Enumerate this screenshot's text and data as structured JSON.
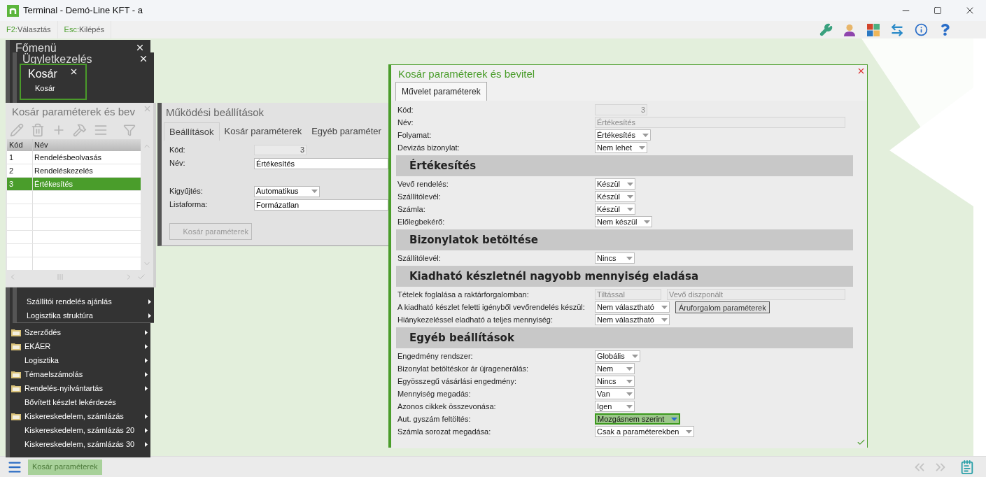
{
  "window": {
    "title": "Terminal - Demó-Line KFT - a"
  },
  "hints": [
    {
      "key": "F2:",
      "label": "Választás"
    },
    {
      "key": "Esc:",
      "label": "Kilépés"
    }
  ],
  "main_menu": {
    "title": "Főmenü",
    "items": [
      {
        "label": "Szerződés",
        "icon": true,
        "submenu": true
      },
      {
        "label": "EKÁER",
        "icon": true,
        "submenu": true
      },
      {
        "label": "Logisztika",
        "icon": false,
        "submenu": true
      },
      {
        "label": "Témaelszámolás",
        "icon": true,
        "submenu": true
      },
      {
        "label": "Rendelés-nyilvántartás",
        "icon": true,
        "submenu": true
      },
      {
        "label": "Bővített készlet lekérdezés",
        "icon": false,
        "submenu": false
      },
      {
        "label": "Kiskereskedelem, számlázás",
        "icon": true,
        "submenu": true
      },
      {
        "label": "Kiskereskedelem, számlázás 20",
        "icon": false,
        "submenu": true
      },
      {
        "label": "Kiskereskedelem, számlázás 30",
        "icon": false,
        "submenu": true
      }
    ]
  },
  "sub_menu": {
    "title": "Ügyletkezelés",
    "items": [
      {
        "label": "Szállítói rendelés ajánlás",
        "submenu": true
      },
      {
        "label": "Logisztika struktúra",
        "submenu": true
      }
    ]
  },
  "basket_menu": {
    "title": "Kosár",
    "items": [
      {
        "label": "Kosár"
      }
    ]
  },
  "list_window": {
    "title": "Kosár paraméterek és bev",
    "columns": [
      "Kód",
      "Név"
    ],
    "rows": [
      {
        "code": "1",
        "name": "Rendelésbeolvasás",
        "selected": false
      },
      {
        "code": "2",
        "name": "Rendeléskezelés",
        "selected": false
      },
      {
        "code": "3",
        "name": "Értékesítés",
        "selected": true
      }
    ]
  },
  "settings_window": {
    "title": "Működési beállítások",
    "tabs": [
      {
        "label": "Beállítások",
        "selected": true
      },
      {
        "label": "Kosár paraméterek",
        "selected": false
      },
      {
        "label": "Egyéb paraméter",
        "selected": false
      }
    ],
    "fields": [
      {
        "label": "Kód:",
        "value": "3",
        "kind": "number"
      },
      {
        "label": "Név:",
        "value": "Értékesítés",
        "kind": "text"
      },
      {
        "label": "Kigyűjtés:",
        "value": "Automatikus",
        "kind": "select"
      },
      {
        "label": "Listaforma:",
        "value": "Formázatlan",
        "kind": "text"
      }
    ],
    "button": {
      "label": "Kosár paraméterek",
      "disabled": true
    }
  },
  "dialog": {
    "title": "Kosár paraméterek és bevitel",
    "tabs": [
      {
        "label": "Művelet paraméterek",
        "selected": true
      }
    ],
    "rows": [
      {
        "kind": "number",
        "label": "Kód:",
        "value": "3",
        "disabled": true,
        "focused": false
      },
      {
        "kind": "text",
        "label": "Név:",
        "value": "Értékesítés",
        "disabled": true,
        "focused": false
      },
      {
        "kind": "select",
        "label": "Folyamat:",
        "value": "Értékesítés",
        "disabled": false,
        "focused": false
      },
      {
        "kind": "select",
        "label": "Devizás bizonylat:",
        "value": "Nem lehet",
        "disabled": false,
        "focused": false
      },
      {
        "kind": "heading",
        "label": "Értékesítés"
      },
      {
        "kind": "select",
        "label": "Vevő rendelés:",
        "value": "Készül",
        "disabled": false,
        "focused": false
      },
      {
        "kind": "select",
        "label": "Szállítólevél:",
        "value": "Készül",
        "disabled": false,
        "focused": false
      },
      {
        "kind": "select",
        "label": "Számla:",
        "value": "Készül",
        "disabled": false,
        "focused": false
      },
      {
        "kind": "select",
        "label": "Előlegbekérő:",
        "value": "Nem készül",
        "disabled": false,
        "focused": false
      },
      {
        "kind": "heading",
        "label": "Bizonylatok betöltése"
      },
      {
        "kind": "select",
        "label": "Szállítólevél:",
        "value": "Nincs",
        "disabled": false,
        "focused": false
      },
      {
        "kind": "heading",
        "label": "Kiadható készletnél nagyobb mennyiség eladása"
      },
      {
        "kind": "pair",
        "label": "Tételek foglalása a raktárforgalomban:",
        "value": "Tiltással",
        "value2": "Vevő diszponált",
        "disabled": true,
        "focused": false
      },
      {
        "kind": "select",
        "label": "A kiadható készlet feletti igényből vevőrendelés készül:",
        "value": "Nem választható",
        "button": "Áruforgalom paraméterek",
        "disabled": false,
        "focused": false
      },
      {
        "kind": "select",
        "label": "Hiánykezeléssel eladható a teljes mennyiség:",
        "value": "Nem választható",
        "disabled": false,
        "focused": false
      },
      {
        "kind": "heading",
        "label": "Egyéb beállítások"
      },
      {
        "kind": "select",
        "label": "Engedmény rendszer:",
        "value": "Globális",
        "disabled": false,
        "focused": false
      },
      {
        "kind": "select",
        "label": "Bizonylat betöltéskor ár újragenerálás:",
        "value": "Nem",
        "disabled": false,
        "focused": false
      },
      {
        "kind": "select",
        "label": "Egyösszegű vásárlási engedmény:",
        "value": "Nincs",
        "disabled": false,
        "focused": false
      },
      {
        "kind": "select",
        "label": "Mennyiség megadás:",
        "value": "Van",
        "disabled": false,
        "focused": false
      },
      {
        "kind": "select",
        "label": "Azonos cikkek összevonása:",
        "value": "Igen",
        "disabled": false,
        "focused": false
      },
      {
        "kind": "select",
        "label": "Aut. gyszám feltöltés:",
        "value": "Mozgásnem szerint",
        "disabled": false,
        "focused": true
      },
      {
        "kind": "select",
        "label": "Számla sorozat megadása:",
        "value": "Csak a paraméterekben",
        "disabled": false,
        "focused": false
      }
    ]
  },
  "taskbar": {
    "items": [
      {
        "label": "Kosár paraméterek",
        "selected": true
      }
    ]
  }
}
